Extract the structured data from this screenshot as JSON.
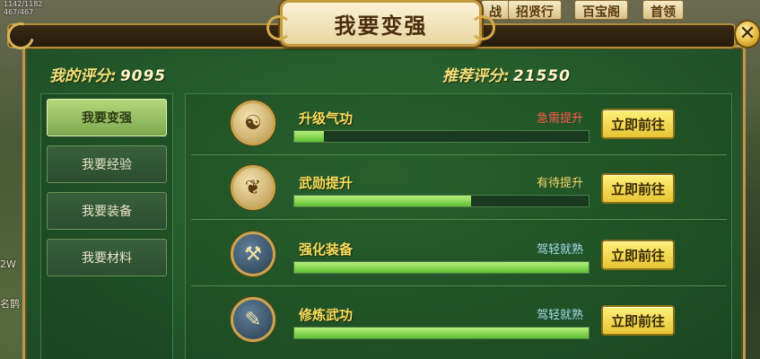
{
  "window": {
    "title": "我要变强",
    "close_label": "✕"
  },
  "background": {
    "hp_stat": "1142/1182",
    "mp_stat": "467/467",
    "top_buttons": [
      "战",
      "招贤行",
      "百宝阁",
      "首领"
    ],
    "left_texts": [
      "2W",
      "名鹊"
    ]
  },
  "scores": {
    "my_label": "我的评分:",
    "my_value": "9095",
    "recommended_label": "推荐评分:",
    "recommended_value": "21550"
  },
  "sidebar": {
    "items": [
      {
        "label": "我要变强",
        "active": true
      },
      {
        "label": "我要经验",
        "active": false
      },
      {
        "label": "我要装备",
        "active": false
      },
      {
        "label": "我要材料",
        "active": false
      }
    ]
  },
  "rows": [
    {
      "name": "升级气功",
      "status": "急需提升",
      "status_color": "#ff5a4a",
      "progress": 0.1,
      "icon": "meditation-icon",
      "button": "立即前往"
    },
    {
      "name": "武勋提升",
      "status": "有待提升",
      "status_color": "#f6d96a",
      "progress": 0.6,
      "icon": "wings-medal-icon",
      "button": "立即前往"
    },
    {
      "name": "强化装备",
      "status": "驾轻就熟",
      "status_color": "#a6ddf0",
      "progress": 1.0,
      "icon": "forge-hammer-icon",
      "button": "立即前往"
    },
    {
      "name": "修炼武功",
      "status": "驾轻就熟",
      "status_color": "#a6ddf0",
      "progress": 1.0,
      "icon": "martial-book-icon",
      "button": "立即前往"
    }
  ],
  "colors": {
    "panel_green": "#245a2b",
    "accent_gold": "#f4e079",
    "button_yellow": "#e6c532"
  }
}
